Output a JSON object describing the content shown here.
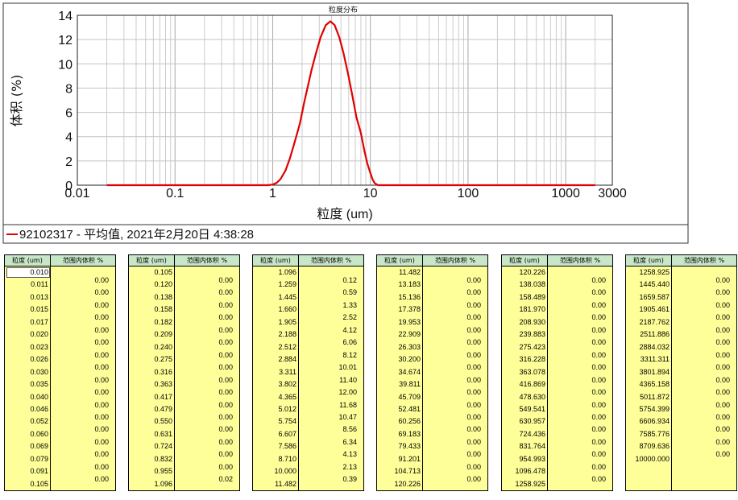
{
  "chart_data": {
    "type": "line",
    "title": "粒度分布",
    "xlabel": "粒度 (um)",
    "ylabel": "体积 (%)",
    "x_scale": "log",
    "xlim": [
      0.01,
      3000
    ],
    "ylim": [
      0,
      14
    ],
    "x_ticks": [
      "0.01",
      "0.1",
      "1",
      "10",
      "100",
      "1000",
      "3000"
    ],
    "y_ticks": [
      "0",
      "2",
      "4",
      "6",
      "8",
      "10",
      "12",
      "14"
    ],
    "grid": true,
    "legend_position": "bottom",
    "series": [
      {
        "name": "92102317 - 平均值, 2021年2月20日 4:38:28",
        "color": "#e00000",
        "x": [
          0.02,
          0.9,
          1.0,
          1.1,
          1.2,
          1.35,
          1.5,
          1.7,
          1.9,
          2.1,
          2.3,
          2.5,
          2.8,
          3.1,
          3.5,
          3.9,
          4.3,
          4.8,
          5.3,
          5.9,
          6.5,
          7.2,
          8.0,
          8.7,
          9.3,
          10.0,
          10.5,
          11.0,
          11.5,
          12.0,
          2000
        ],
        "y": [
          0,
          0,
          0.05,
          0.2,
          0.5,
          1.2,
          2.2,
          3.7,
          5.1,
          6.8,
          8.2,
          9.5,
          11.0,
          12.2,
          13.2,
          13.5,
          13.2,
          12.2,
          10.9,
          9.2,
          7.5,
          5.6,
          4.3,
          2.8,
          1.8,
          1.0,
          0.5,
          0.2,
          0.08,
          0,
          0
        ]
      }
    ]
  },
  "table": {
    "header_size": "粒度 (um)",
    "header_volume": "范围内体积 %",
    "panels": [
      {
        "sizes": [
          "0.010",
          "0.011",
          "0.013",
          "0.015",
          "0.017",
          "0.020",
          "0.023",
          "0.026",
          "0.030",
          "0.035",
          "0.040",
          "0.046",
          "0.052",
          "0.060",
          "0.069",
          "0.079",
          "0.091",
          "0.105"
        ],
        "values": [
          "0.00",
          "0.00",
          "0.00",
          "0.00",
          "0.00",
          "0.00",
          "0.00",
          "0.00",
          "0.00",
          "0.00",
          "0.00",
          "0.00",
          "0.00",
          "0.00",
          "0.00",
          "0.00",
          "0.00"
        ]
      },
      {
        "sizes": [
          "0.105",
          "0.120",
          "0.138",
          "0.158",
          "0.182",
          "0.209",
          "0.240",
          "0.275",
          "0.316",
          "0.363",
          "0.417",
          "0.479",
          "0.550",
          "0.631",
          "0.724",
          "0.832",
          "0.955",
          "1.096"
        ],
        "values": [
          "0.00",
          "0.00",
          "0.00",
          "0.00",
          "0.00",
          "0.00",
          "0.00",
          "0.00",
          "0.00",
          "0.00",
          "0.00",
          "0.00",
          "0.00",
          "0.00",
          "0.00",
          "0.00",
          "0.02"
        ]
      },
      {
        "sizes": [
          "1.096",
          "1.259",
          "1.445",
          "1.660",
          "1.905",
          "2.188",
          "2.512",
          "2.884",
          "3.311",
          "3.802",
          "4.365",
          "5.012",
          "5.754",
          "6.607",
          "7.586",
          "8.710",
          "10.000",
          "11.482"
        ],
        "values": [
          "0.12",
          "0.59",
          "1.33",
          "2.52",
          "4.12",
          "6.06",
          "8.12",
          "10.01",
          "11.40",
          "12.00",
          "11.68",
          "10.47",
          "8.56",
          "6.34",
          "4.13",
          "2.13",
          "0.39"
        ]
      },
      {
        "sizes": [
          "11.482",
          "13.183",
          "15.136",
          "17.378",
          "19.953",
          "22.909",
          "26.303",
          "30.200",
          "34.674",
          "39.811",
          "45.709",
          "52.481",
          "60.256",
          "69.183",
          "79.433",
          "91.201",
          "104.713",
          "120.226"
        ],
        "values": [
          "0.00",
          "0.00",
          "0.00",
          "0.00",
          "0.00",
          "0.00",
          "0.00",
          "0.00",
          "0.00",
          "0.00",
          "0.00",
          "0.00",
          "0.00",
          "0.00",
          "0.00",
          "0.00",
          "0.00"
        ]
      },
      {
        "sizes": [
          "120.226",
          "138.038",
          "158.489",
          "181.970",
          "208.930",
          "239.883",
          "275.423",
          "316.228",
          "363.078",
          "416.869",
          "478.630",
          "549.541",
          "630.957",
          "724.436",
          "831.764",
          "954.993",
          "1096.478",
          "1258.925"
        ],
        "values": [
          "0.00",
          "0.00",
          "0.00",
          "0.00",
          "0.00",
          "0.00",
          "0.00",
          "0.00",
          "0.00",
          "0.00",
          "0.00",
          "0.00",
          "0.00",
          "0.00",
          "0.00",
          "0.00",
          "0.00"
        ]
      },
      {
        "sizes": [
          "1258.925",
          "1445.440",
          "1659.587",
          "1905.461",
          "2187.762",
          "2511.886",
          "2884.032",
          "3311.311",
          "3801.894",
          "4365.158",
          "5011.872",
          "5754.399",
          "6606.934",
          "7585.776",
          "8709.636",
          "10000.000"
        ],
        "values": [
          "0.00",
          "0.00",
          "0.00",
          "0.00",
          "0.00",
          "0.00",
          "0.00",
          "0.00",
          "0.00",
          "0.00",
          "0.00",
          "0.00",
          "0.00",
          "0.00",
          "0.00"
        ]
      }
    ]
  },
  "colors": {
    "header_bg": "#c8e6c8",
    "cell_bg": "#ffff99",
    "series_line": "#e00000",
    "grid": "#c0c0c0"
  }
}
